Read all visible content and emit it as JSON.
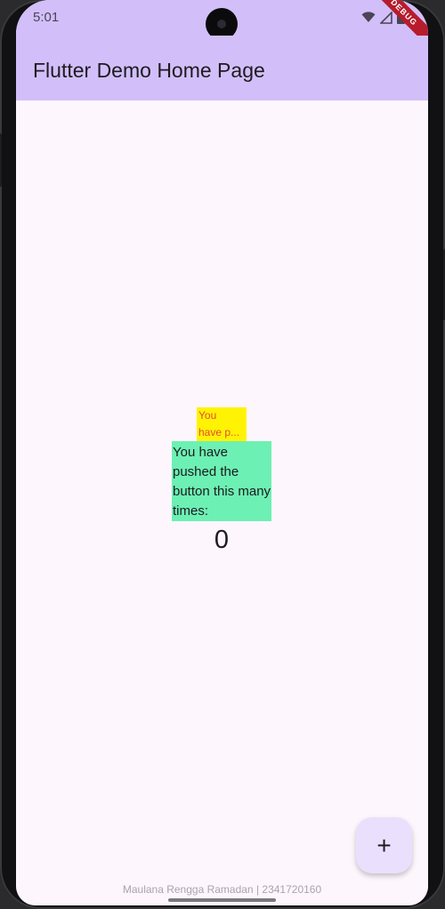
{
  "status_bar": {
    "time": "5:01",
    "icons": [
      "wifi-icon",
      "signal-icon",
      "battery-icon"
    ],
    "debug_banner": "DEBUG"
  },
  "app_bar": {
    "title": "Flutter Demo Home Page",
    "color": "#d2bff9"
  },
  "body": {
    "yellow_text_line1": "You",
    "yellow_text_line2": "have p...",
    "green_text": "You have pushed the button this many times:",
    "counter": "0"
  },
  "fab": {
    "label": "+",
    "icon": "add-icon"
  },
  "footer": {
    "text": "Maulana Rengga Ramadan | 2341720160"
  }
}
